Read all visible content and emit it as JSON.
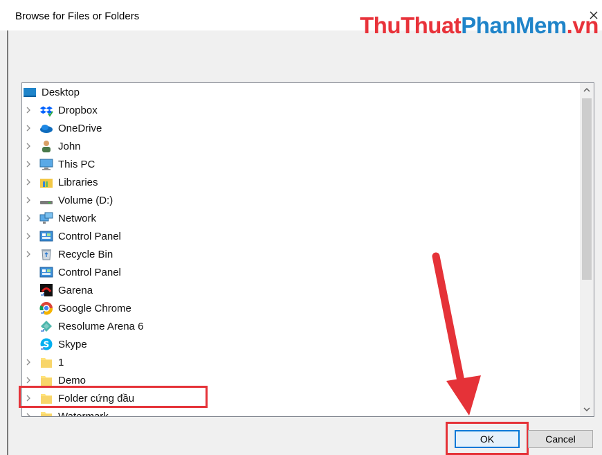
{
  "dialog": {
    "title": "Browse for Files or Folders",
    "close_label": "×"
  },
  "watermark": {
    "part1": "ThuThuat",
    "part2": "PhanMem",
    "part3": ".vn"
  },
  "tree": {
    "root": {
      "label": "Desktop",
      "icon": "desktop-icon"
    },
    "items": [
      {
        "label": "Dropbox",
        "icon": "dropbox-icon",
        "expandable": true
      },
      {
        "label": "OneDrive",
        "icon": "onedrive-icon",
        "expandable": true
      },
      {
        "label": "John",
        "icon": "user-icon",
        "expandable": true
      },
      {
        "label": "This PC",
        "icon": "computer-icon",
        "expandable": true
      },
      {
        "label": "Libraries",
        "icon": "libraries-icon",
        "expandable": true
      },
      {
        "label": "Volume (D:)",
        "icon": "drive-icon",
        "expandable": true
      },
      {
        "label": "Network",
        "icon": "network-icon",
        "expandable": true
      },
      {
        "label": "Control Panel",
        "icon": "control-panel-icon",
        "expandable": true
      },
      {
        "label": "Recycle Bin",
        "icon": "recycle-bin-icon",
        "expandable": true
      },
      {
        "label": "Control Panel",
        "icon": "control-panel-icon",
        "expandable": false
      },
      {
        "label": "Garena",
        "icon": "garena-icon",
        "expandable": false
      },
      {
        "label": "Google Chrome",
        "icon": "chrome-icon",
        "expandable": false
      },
      {
        "label": "Resolume Arena 6",
        "icon": "resolume-icon",
        "expandable": false
      },
      {
        "label": "Skype",
        "icon": "skype-icon",
        "expandable": false
      },
      {
        "label": "1",
        "icon": "folder-icon",
        "expandable": true
      },
      {
        "label": "Demo",
        "icon": "folder-icon",
        "expandable": true
      },
      {
        "label": "Folder cứng đầu",
        "icon": "folder-icon",
        "expandable": true,
        "highlighted": true
      },
      {
        "label": "Watermark",
        "icon": "folder-icon",
        "expandable": true
      }
    ]
  },
  "buttons": {
    "ok": "OK",
    "cancel": "Cancel"
  },
  "colors": {
    "highlight_red": "#e53238",
    "accent_blue": "#0078d7"
  }
}
